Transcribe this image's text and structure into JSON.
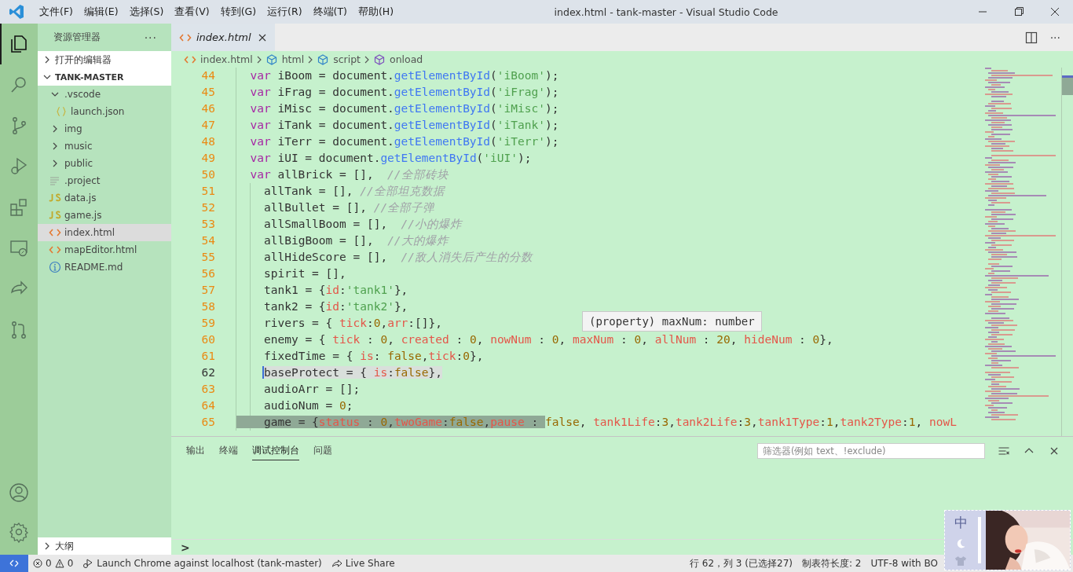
{
  "window": {
    "title": "index.html - tank-master - Visual Studio Code",
    "menu": [
      "文件(F)",
      "编辑(E)",
      "选择(S)",
      "查看(V)",
      "转到(G)",
      "运行(R)",
      "终端(T)",
      "帮助(H)"
    ]
  },
  "activity_bar": {
    "top": [
      {
        "kind": "files",
        "selected": true
      },
      {
        "kind": "search",
        "selected": false
      },
      {
        "kind": "branch",
        "selected": false
      },
      {
        "kind": "debug",
        "selected": false
      },
      {
        "kind": "extensions",
        "selected": false
      },
      {
        "kind": "remote",
        "selected": false
      },
      {
        "kind": "share",
        "selected": false
      },
      {
        "kind": "pull",
        "selected": false
      }
    ],
    "bottom": [
      {
        "kind": "account"
      },
      {
        "kind": "settings"
      }
    ]
  },
  "sidebar": {
    "title": "资源管理器",
    "more": "···",
    "sections": [
      {
        "label": "打开的编辑器",
        "expanded": false
      },
      {
        "label": "TANK-MASTER",
        "expanded": true,
        "items": [
          {
            "label": ".vscode",
            "kind": "folder",
            "expanded": true,
            "selected": false,
            "children": [
              {
                "label": "launch.json",
                "kind": "json",
                "selected": false
              }
            ]
          },
          {
            "label": "img",
            "kind": "folder",
            "expanded": false,
            "selected": false
          },
          {
            "label": "music",
            "kind": "folder",
            "expanded": false,
            "selected": false
          },
          {
            "label": "public",
            "kind": "folder",
            "expanded": false,
            "selected": false
          },
          {
            "label": ".project",
            "kind": "text",
            "selected": false
          },
          {
            "label": "data.js",
            "kind": "js",
            "selected": false
          },
          {
            "label": "game.js",
            "kind": "js",
            "selected": false
          },
          {
            "label": "index.html",
            "kind": "html",
            "selected": true
          },
          {
            "label": "mapEditor.html",
            "kind": "html",
            "selected": false
          },
          {
            "label": "README.md",
            "kind": "info",
            "selected": false
          }
        ]
      }
    ],
    "outline": {
      "label": "大纲",
      "expanded": false
    }
  },
  "editor": {
    "tabs": [
      {
        "label": "index.html",
        "kind": "html",
        "selected": true,
        "preview": true
      }
    ],
    "more": "···",
    "breadcrumbs": [
      {
        "label": "index.html",
        "kind": "html"
      },
      {
        "label": "html",
        "kind": "element"
      },
      {
        "label": "script",
        "kind": "element"
      },
      {
        "label": "onload",
        "kind": "method"
      }
    ],
    "lines": [
      {
        "number": "44",
        "kind": "statement",
        "selected": false,
        "tokens": [
          {
            "text": "var",
            "kind": "kw"
          },
          {
            "text": " iBoom = document.",
            "kind": "plain"
          },
          {
            "text": "getElementById",
            "kind": "fn"
          },
          {
            "text": "(",
            "kind": "plain"
          },
          {
            "text": "'iBoom'",
            "kind": "str"
          },
          {
            "text": ");",
            "kind": "plain"
          }
        ]
      },
      {
        "number": "45",
        "kind": "statement",
        "selected": false,
        "tokens": [
          {
            "text": "var",
            "kind": "kw"
          },
          {
            "text": " iFrag = document.",
            "kind": "plain"
          },
          {
            "text": "getElementById",
            "kind": "fn"
          },
          {
            "text": "(",
            "kind": "plain"
          },
          {
            "text": "'iFrag'",
            "kind": "str"
          },
          {
            "text": ");",
            "kind": "plain"
          }
        ]
      },
      {
        "number": "46",
        "kind": "statement",
        "selected": false,
        "tokens": [
          {
            "text": "var",
            "kind": "kw"
          },
          {
            "text": " iMisc = document.",
            "kind": "plain"
          },
          {
            "text": "getElementById",
            "kind": "fn"
          },
          {
            "text": "(",
            "kind": "plain"
          },
          {
            "text": "'iMisc'",
            "kind": "str"
          },
          {
            "text": ");",
            "kind": "plain"
          }
        ]
      },
      {
        "number": "47",
        "kind": "statement",
        "selected": false,
        "tokens": [
          {
            "text": "var",
            "kind": "kw"
          },
          {
            "text": " iTank = document.",
            "kind": "plain"
          },
          {
            "text": "getElementById",
            "kind": "fn"
          },
          {
            "text": "(",
            "kind": "plain"
          },
          {
            "text": "'iTank'",
            "kind": "str"
          },
          {
            "text": ");",
            "kind": "plain"
          }
        ]
      },
      {
        "number": "48",
        "kind": "statement",
        "selected": false,
        "tokens": [
          {
            "text": "var",
            "kind": "kw"
          },
          {
            "text": " iTerr = document.",
            "kind": "plain"
          },
          {
            "text": "getElementById",
            "kind": "fn"
          },
          {
            "text": "(",
            "kind": "plain"
          },
          {
            "text": "'iTerr'",
            "kind": "str"
          },
          {
            "text": ");",
            "kind": "plain"
          }
        ]
      },
      {
        "number": "49",
        "kind": "statement",
        "selected": false,
        "tokens": [
          {
            "text": "var",
            "kind": "kw"
          },
          {
            "text": " iUI = document.",
            "kind": "plain"
          },
          {
            "text": "getElementById",
            "kind": "fn"
          },
          {
            "text": "(",
            "kind": "plain"
          },
          {
            "text": "'iUI'",
            "kind": "str"
          },
          {
            "text": ");",
            "kind": "plain"
          }
        ]
      },
      {
        "number": "50",
        "kind": "statement",
        "selected": false,
        "tokens": [
          {
            "text": "var",
            "kind": "kw"
          },
          {
            "text": " allBrick = [],  ",
            "kind": "plain"
          },
          {
            "text": "//全部砖块",
            "kind": "com"
          }
        ]
      },
      {
        "number": "51",
        "kind": "continuation",
        "selected": false,
        "tokens": [
          {
            "text": "allTank = [], ",
            "kind": "plain"
          },
          {
            "text": "//全部坦克数据",
            "kind": "com"
          }
        ]
      },
      {
        "number": "52",
        "kind": "continuation",
        "selected": false,
        "tokens": [
          {
            "text": "allBullet = [], ",
            "kind": "plain"
          },
          {
            "text": "//全部子弹",
            "kind": "com"
          }
        ]
      },
      {
        "number": "53",
        "kind": "continuation",
        "selected": false,
        "tokens": [
          {
            "text": "allSmallBoom = [],  ",
            "kind": "plain"
          },
          {
            "text": "//小的爆炸",
            "kind": "com"
          }
        ]
      },
      {
        "number": "54",
        "kind": "continuation",
        "selected": false,
        "tokens": [
          {
            "text": "allBigBoom = [],  ",
            "kind": "plain"
          },
          {
            "text": "//大的爆炸",
            "kind": "com"
          }
        ]
      },
      {
        "number": "55",
        "kind": "continuation",
        "selected": false,
        "tokens": [
          {
            "text": "allHideScore = [],  ",
            "kind": "plain"
          },
          {
            "text": "//敌人消失后产生的分数",
            "kind": "com"
          }
        ]
      },
      {
        "number": "56",
        "kind": "continuation",
        "selected": false,
        "tokens": [
          {
            "text": "spirit = [],",
            "kind": "plain"
          }
        ]
      },
      {
        "number": "57",
        "kind": "continuation",
        "selected": false,
        "tokens": [
          {
            "text": "tank1 = {",
            "kind": "plain"
          },
          {
            "text": "id",
            "kind": "prop"
          },
          {
            "text": ":",
            "kind": "plain"
          },
          {
            "text": "'tank1'",
            "kind": "str"
          },
          {
            "text": "},",
            "kind": "plain"
          }
        ]
      },
      {
        "number": "58",
        "kind": "continuation",
        "selected": false,
        "tokens": [
          {
            "text": "tank2 = {",
            "kind": "plain"
          },
          {
            "text": "id",
            "kind": "prop"
          },
          {
            "text": ":",
            "kind": "plain"
          },
          {
            "text": "'tank2'",
            "kind": "str"
          },
          {
            "text": "},",
            "kind": "plain"
          }
        ]
      },
      {
        "number": "59",
        "kind": "continuation",
        "selected": false,
        "tokens": [
          {
            "text": "rivers = { ",
            "kind": "plain"
          },
          {
            "text": "tick",
            "kind": "prop"
          },
          {
            "text": ":",
            "kind": "plain"
          },
          {
            "text": "0",
            "kind": "num"
          },
          {
            "text": ",",
            "kind": "plain"
          },
          {
            "text": "arr",
            "kind": "prop"
          },
          {
            "text": ":[]},",
            "kind": "plain"
          }
        ]
      },
      {
        "number": "60",
        "kind": "continuation",
        "selected": false,
        "tokens": [
          {
            "text": "enemy = { ",
            "kind": "plain"
          },
          {
            "text": "tick",
            "kind": "prop"
          },
          {
            "text": " : ",
            "kind": "plain"
          },
          {
            "text": "0",
            "kind": "num"
          },
          {
            "text": ", ",
            "kind": "plain"
          },
          {
            "text": "created",
            "kind": "prop"
          },
          {
            "text": " : ",
            "kind": "plain"
          },
          {
            "text": "0",
            "kind": "num"
          },
          {
            "text": ", ",
            "kind": "plain"
          },
          {
            "text": "nowNum",
            "kind": "prop"
          },
          {
            "text": " : ",
            "kind": "plain"
          },
          {
            "text": "0",
            "kind": "num"
          },
          {
            "text": ", ",
            "kind": "plain"
          },
          {
            "text": "maxNum",
            "kind": "prop"
          },
          {
            "text": " : ",
            "kind": "plain"
          },
          {
            "text": "0",
            "kind": "num"
          },
          {
            "text": ", ",
            "kind": "plain"
          },
          {
            "text": "allNum",
            "kind": "prop"
          },
          {
            "text": " : ",
            "kind": "plain"
          },
          {
            "text": "20",
            "kind": "num"
          },
          {
            "text": ", ",
            "kind": "plain"
          },
          {
            "text": "hideNum",
            "kind": "prop"
          },
          {
            "text": " : ",
            "kind": "plain"
          },
          {
            "text": "0",
            "kind": "num"
          },
          {
            "text": "},",
            "kind": "plain"
          }
        ]
      },
      {
        "number": "61",
        "kind": "continuation",
        "selected": false,
        "tokens": [
          {
            "text": "fixedTime = { ",
            "kind": "plain"
          },
          {
            "text": "is",
            "kind": "prop"
          },
          {
            "text": ": ",
            "kind": "plain"
          },
          {
            "text": "false",
            "kind": "num"
          },
          {
            "text": ",",
            "kind": "plain"
          },
          {
            "text": "tick",
            "kind": "prop"
          },
          {
            "text": ":",
            "kind": "plain"
          },
          {
            "text": "0",
            "kind": "num"
          },
          {
            "text": "},",
            "kind": "plain"
          }
        ]
      },
      {
        "number": "62",
        "kind": "continuation",
        "selected": true,
        "tokens": [
          {
            "text": "baseProtect = { ",
            "kind": "plain"
          },
          {
            "text": "is",
            "kind": "prop"
          },
          {
            "text": ":",
            "kind": "plain"
          },
          {
            "text": "false",
            "kind": "num"
          },
          {
            "text": "},",
            "kind": "plain"
          }
        ]
      },
      {
        "number": "63",
        "kind": "continuation",
        "selected": false,
        "tokens": [
          {
            "text": "audioArr = [];",
            "kind": "plain"
          }
        ]
      },
      {
        "number": "64",
        "kind": "continuation",
        "selected": false,
        "tokens": [
          {
            "text": "audioNum = ",
            "kind": "plain"
          },
          {
            "text": "0",
            "kind": "num"
          },
          {
            "text": ";",
            "kind": "plain"
          }
        ]
      },
      {
        "number": "65",
        "kind": "continuation",
        "selected": false,
        "marked": [
          {
            "text": "game = {",
            "kind": "plain"
          },
          {
            "text": "status",
            "kind": "prop"
          },
          {
            "text": " : ",
            "kind": "plain"
          },
          {
            "text": "0",
            "kind": "num"
          },
          {
            "text": ",",
            "kind": "plain"
          },
          {
            "text": "twoGame",
            "kind": "prop"
          },
          {
            "text": ":",
            "kind": "plain"
          },
          {
            "text": "false",
            "kind": "num"
          },
          {
            "text": ",",
            "kind": "plain"
          },
          {
            "text": "pause",
            "kind": "prop"
          },
          {
            "text": " : ",
            "kind": "plain"
          }
        ],
        "tokens": [
          {
            "text": "false",
            "kind": "num"
          },
          {
            "text": ", ",
            "kind": "plain"
          },
          {
            "text": "tank1Life",
            "kind": "prop"
          },
          {
            "text": ":",
            "kind": "plain"
          },
          {
            "text": "3",
            "kind": "num"
          },
          {
            "text": ",",
            "kind": "plain"
          },
          {
            "text": "tank2Life",
            "kind": "prop"
          },
          {
            "text": ":",
            "kind": "plain"
          },
          {
            "text": "3",
            "kind": "num"
          },
          {
            "text": ",",
            "kind": "plain"
          },
          {
            "text": "tank1Type",
            "kind": "prop"
          },
          {
            "text": ":",
            "kind": "plain"
          },
          {
            "text": "1",
            "kind": "num"
          },
          {
            "text": ",",
            "kind": "plain"
          },
          {
            "text": "tank2Type",
            "kind": "prop"
          },
          {
            "text": ":",
            "kind": "plain"
          },
          {
            "text": "1",
            "kind": "num"
          },
          {
            "text": ", ",
            "kind": "plain"
          },
          {
            "text": "nowL",
            "kind": "prop"
          }
        ]
      }
    ],
    "hover": "(property) maxNum: number"
  },
  "panel": {
    "tabs": [
      {
        "label": "输出",
        "selected": false
      },
      {
        "label": "终端",
        "selected": false
      },
      {
        "label": "调试控制台",
        "selected": true
      },
      {
        "label": "问题",
        "selected": false
      }
    ],
    "filter": {
      "placeholder": "筛选器(例如 text、!exclude)"
    },
    "prompt": ">"
  },
  "status_bar": {
    "left": [
      {
        "kind": "remote"
      },
      {
        "kind": "problems",
        "errors": "0",
        "warnings": "0"
      },
      {
        "kind": "launch",
        "text": "Launch Chrome against localhost (tank-master)"
      },
      {
        "kind": "share",
        "text": "Live Share"
      }
    ],
    "right": [
      {
        "kind": "text",
        "text": "行 62，列 3 (已选择27)"
      },
      {
        "kind": "text",
        "text": "制表符长度: 2"
      },
      {
        "kind": "text",
        "text": "UTF-8 with BO"
      }
    ]
  },
  "ime": {
    "mode": "中"
  }
}
